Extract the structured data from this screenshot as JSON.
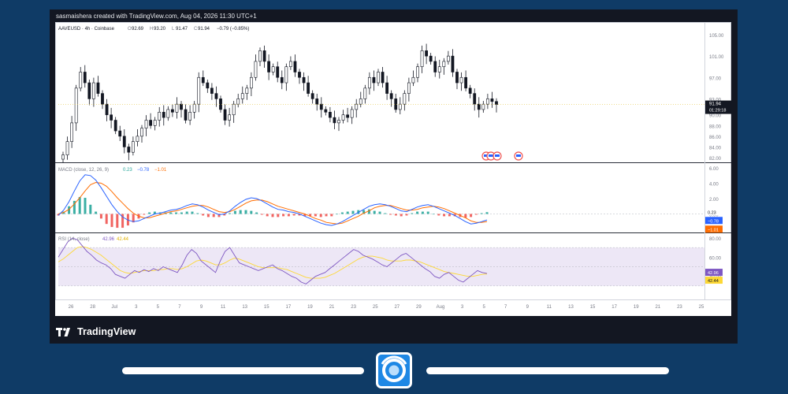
{
  "credit": "sasmaishera created with TradingView.com, Aug 04, 2026 11:30 UTC+1",
  "brand": {
    "footer_text": "TradingView"
  },
  "chart_data": [
    {
      "type": "candlestick",
      "pane": "price",
      "legend": {
        "symbol": "AAVEUSD · 4h · Coinbase",
        "ohlc": [
          {
            "k": "O",
            "v": "92.69"
          },
          {
            "k": "H",
            "v": "93.20"
          },
          {
            "k": "L",
            "v": "91.47"
          },
          {
            "k": "C",
            "v": "91.94"
          }
        ],
        "change": "−0.79 (−0.85%)"
      },
      "y_ticks": [
        "105.00",
        "101.00",
        "97.00",
        "93.00",
        "90.00",
        "88.00",
        "86.00",
        "84.00",
        "82.00"
      ],
      "ylim": [
        82,
        105
      ],
      "last_price": "91.94",
      "countdown": "01:29:18",
      "close_series": [
        82.5,
        85,
        88.5,
        95,
        98,
        96,
        93,
        96,
        94,
        92,
        90,
        89,
        87,
        86,
        84,
        83,
        85,
        86,
        87.5,
        89,
        88,
        89,
        90.5,
        89.5,
        91,
        90.5,
        92,
        91,
        89,
        90.5,
        92,
        97,
        96,
        95,
        94,
        93,
        91,
        89,
        90,
        92,
        93,
        94,
        95,
        97,
        100,
        102,
        100,
        98,
        99,
        97,
        96,
        99,
        100,
        98,
        97,
        96,
        94,
        93,
        92,
        91,
        90.5,
        89.5,
        88.5,
        89,
        90,
        89.5,
        91,
        92,
        93,
        95,
        97,
        96,
        98,
        96,
        94,
        93,
        91,
        92,
        94,
        96,
        97,
        99,
        102,
        101,
        100,
        98,
        99,
        100,
        101,
        98,
        96,
        97,
        95,
        94,
        92,
        91,
        92,
        93,
        92.5,
        91.94
      ],
      "markers": [
        "flag",
        "flag",
        "flag",
        "flag"
      ]
    },
    {
      "type": "macd",
      "pane": "macd",
      "legend": {
        "title": "MACD (close, 12, 26, 9)",
        "values": [
          "0.23",
          "−0.78",
          "−1.01"
        ]
      },
      "y_ticks": [
        "6.00",
        "4.00",
        "2.00",
        "0.00"
      ],
      "ylim": [
        -2,
        6
      ],
      "last_values": {
        "histogram": "0.23",
        "macd": "−0.78",
        "signal": "−1.01"
      },
      "macd": [
        -0.2,
        0.5,
        1.6,
        3,
        4.3,
        5.1,
        5,
        4.4,
        3.4,
        2.3,
        1.2,
        0.3,
        -0.4,
        -0.8,
        -1,
        -0.9,
        -0.6,
        -0.3,
        0,
        0.1,
        0.3,
        0.5,
        0.6,
        0.8,
        1.1,
        1.3,
        1.2,
        0.9,
        0.5,
        0.2,
        -0.1,
        0,
        0.4,
        1,
        1.5,
        1.9,
        2.1,
        2,
        1.7,
        1.3,
        0.9,
        0.6,
        0.5,
        0.3,
        0.2,
        0,
        -0.3,
        -0.6,
        -0.9,
        -1.2,
        -1.4,
        -1.5,
        -1.3,
        -1,
        -0.6,
        -0.2,
        0.2,
        0.6,
        1,
        1.2,
        1.3,
        1.2,
        1,
        0.7,
        0.4,
        0.3,
        0.6,
        0.9,
        1.1,
        1.2,
        1,
        0.7,
        0.4,
        0.1,
        -0.2,
        -0.6,
        -1,
        -1.3,
        -1.2,
        -1,
        -0.78
      ],
      "signal": [
        0,
        0.2,
        0.6,
        1.3,
        2.1,
        3,
        3.8,
        4.1,
        4,
        3.6,
        2.9,
        2.1,
        1.4,
        0.7,
        0.1,
        -0.3,
        -0.5,
        -0.5,
        -0.3,
        -0.1,
        0.1,
        0.3,
        0.4,
        0.6,
        0.8,
        1,
        1.1,
        1.1,
        0.9,
        0.6,
        0.3,
        0.2,
        0.3,
        0.6,
        1,
        1.4,
        1.7,
        1.8,
        1.8,
        1.6,
        1.3,
        1,
        0.8,
        0.6,
        0.4,
        0.2,
        0,
        -0.3,
        -0.6,
        -0.8,
        -1.1,
        -1.2,
        -1.3,
        -1.2,
        -0.9,
        -0.6,
        -0.3,
        0.1,
        0.4,
        0.8,
        1,
        1.1,
        1.1,
        0.9,
        0.7,
        0.5,
        0.5,
        0.6,
        0.8,
        0.9,
        1,
        0.9,
        0.7,
        0.4,
        0.1,
        -0.2,
        -0.5,
        -0.9,
        -1.1,
        -1.1,
        -1.01
      ]
    },
    {
      "type": "rsi",
      "pane": "rsi",
      "legend": {
        "title": "RSI (14, close)",
        "values": [
          "42.96",
          "42.44"
        ]
      },
      "y_ticks": [
        "80.00",
        "60.00",
        "40.00"
      ],
      "ylim": [
        20,
        80
      ],
      "band": [
        30,
        70
      ],
      "last_values": {
        "rsi": "42.96",
        "ma": "42.44"
      },
      "rsi": [
        60,
        68,
        76,
        80,
        78,
        72,
        66,
        62,
        57,
        54,
        52,
        48,
        42,
        40,
        38,
        42,
        46,
        44,
        47,
        45,
        48,
        46,
        50,
        48,
        46,
        44,
        52,
        62,
        68,
        64,
        56,
        52,
        48,
        44,
        56,
        66,
        70,
        62,
        54,
        52,
        50,
        48,
        46,
        48,
        50,
        52,
        48,
        46,
        43,
        40,
        38,
        34,
        32,
        36,
        40,
        42,
        44,
        48,
        52,
        56,
        60,
        64,
        68,
        66,
        62,
        60,
        58,
        55,
        52,
        50,
        54,
        58,
        62,
        64,
        60,
        56,
        52,
        48,
        45,
        40,
        38,
        42,
        44,
        40,
        36,
        34,
        38,
        42,
        46,
        44,
        42.96
      ],
      "rsi_ma": [
        55,
        58,
        62,
        66,
        70,
        71,
        70,
        68,
        65,
        62,
        58,
        54,
        50,
        46,
        44,
        43,
        44,
        45,
        46,
        46,
        46,
        47,
        47,
        48,
        48,
        47,
        48,
        50,
        53,
        56,
        57,
        56,
        54,
        52,
        52,
        54,
        57,
        59,
        58,
        56,
        54,
        52,
        50,
        49,
        49,
        49,
        49,
        48,
        47,
        45,
        43,
        41,
        39,
        38,
        38,
        38,
        39,
        41,
        43,
        46,
        49,
        52,
        55,
        58,
        60,
        61,
        61,
        60,
        59,
        57,
        56,
        56,
        56,
        57,
        57,
        56,
        55,
        53,
        51,
        49,
        47,
        45,
        44,
        43,
        42,
        41,
        40,
        40,
        41,
        42,
        42.44
      ]
    }
  ],
  "x_axis": {
    "labels": [
      "26",
      "28",
      "Jul",
      "3",
      "5",
      "7",
      "9",
      "11",
      "13",
      "15",
      "17",
      "19",
      "21",
      "23",
      "25",
      "27",
      "29",
      "Aug",
      "3",
      "5",
      "7",
      "9",
      "11",
      "13",
      "15",
      "17",
      "19",
      "21",
      "23",
      "25"
    ]
  },
  "colors": {
    "page_bg": "#0f3b66",
    "frame_bg": "#131722",
    "up": "#26a69a",
    "down": "#ef5350",
    "macd_line": "#2962ff",
    "signal_line": "#ff6d00",
    "rsi_line": "#7e57c2",
    "rsi_ma": "#fdd835",
    "rsi_band": "#ede7f6"
  }
}
